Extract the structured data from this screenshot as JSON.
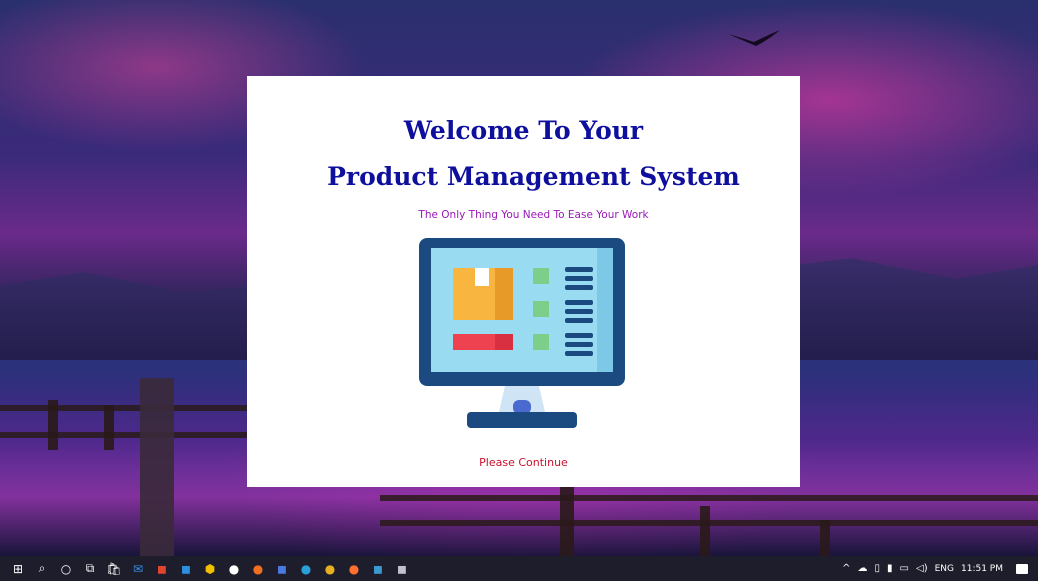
{
  "splash": {
    "title_line1": "Welcome To Your",
    "title_line2": "Product Management System",
    "subtitle": "The Only Thing You Need To Ease Your Work",
    "continue_label": "Please Continue",
    "illustration_icon": "computer-monitor-icon"
  },
  "colors": {
    "title": "#0f0f9e",
    "subtitle": "#9a18b8",
    "continue": "#c8102e",
    "monitor_frame": "#1a4a80",
    "monitor_screen": "#99dcf2",
    "box_orange": "#f8b640",
    "bar_red": "#ee4250",
    "square_green": "#7ccf8a"
  },
  "taskbar": {
    "pinned_icons": [
      {
        "name": "windows-start-icon",
        "glyph": "⊞",
        "color": "#ffffff"
      },
      {
        "name": "search-icon",
        "glyph": "⌕",
        "color": "#ffffff"
      },
      {
        "name": "cortana-icon",
        "glyph": "○",
        "color": "#ffffff"
      },
      {
        "name": "task-view-icon",
        "glyph": "⧉",
        "color": "#ffffff"
      },
      {
        "name": "store-icon",
        "glyph": "🛍",
        "color": "#ffffff"
      },
      {
        "name": "mail-icon",
        "glyph": "✉",
        "color": "#3a8ee6"
      },
      {
        "name": "office-icon",
        "glyph": "◼",
        "color": "#e2442f"
      },
      {
        "name": "vscode-icon",
        "glyph": "◼",
        "color": "#2d8fe0"
      },
      {
        "name": "app-hexagon-icon",
        "glyph": "⬢",
        "color": "#f0c000"
      },
      {
        "name": "app-circle-icon",
        "glyph": "●",
        "color": "#ffffff"
      },
      {
        "name": "app-orange-icon",
        "glyph": "●",
        "color": "#f07020"
      },
      {
        "name": "app-window-icon",
        "glyph": "◼",
        "color": "#4a7adf"
      },
      {
        "name": "edge-icon",
        "glyph": "●",
        "color": "#2aa0d8"
      },
      {
        "name": "chrome-icon",
        "glyph": "●",
        "color": "#e8b020"
      },
      {
        "name": "firefox-icon",
        "glyph": "●",
        "color": "#ff7030"
      },
      {
        "name": "app-teal-icon",
        "glyph": "◼",
        "color": "#3a9ad0"
      },
      {
        "name": "app-gallery-icon",
        "glyph": "◼",
        "color": "#c0c0d0"
      }
    ],
    "tray": {
      "chevron": "^",
      "language": "ENG",
      "clock": "11:51 PM"
    }
  }
}
